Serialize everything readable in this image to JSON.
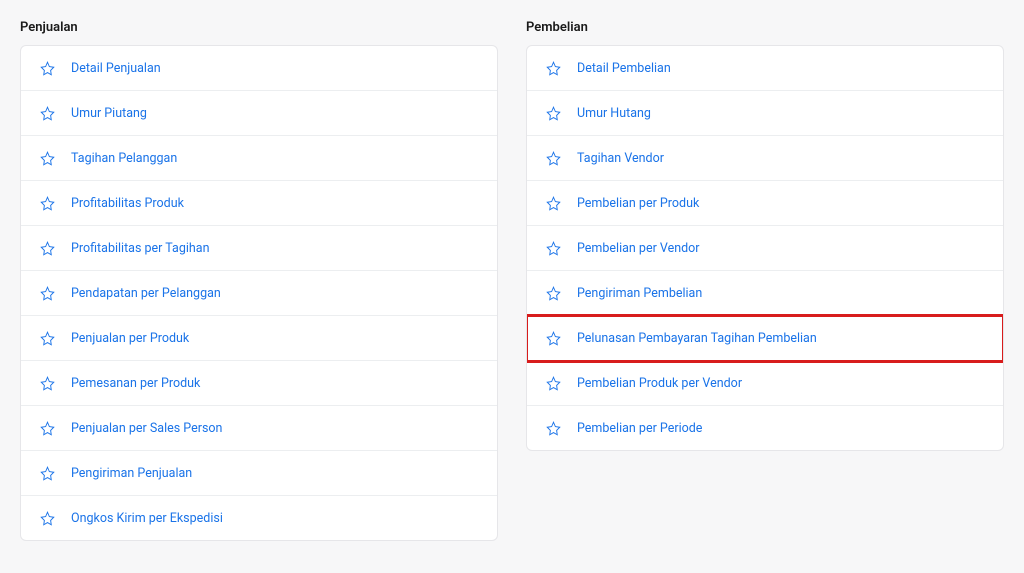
{
  "columns": [
    {
      "title": "Penjualan",
      "items": [
        {
          "label": "Detail Penjualan"
        },
        {
          "label": "Umur Piutang"
        },
        {
          "label": "Tagihan Pelanggan"
        },
        {
          "label": "Profitabilitas Produk"
        },
        {
          "label": "Profitabilitas per Tagihan"
        },
        {
          "label": "Pendapatan per Pelanggan"
        },
        {
          "label": "Penjualan per Produk"
        },
        {
          "label": "Pemesanan per Produk"
        },
        {
          "label": "Penjualan per Sales Person"
        },
        {
          "label": "Pengiriman Penjualan"
        },
        {
          "label": "Ongkos Kirim per Ekspedisi"
        }
      ]
    },
    {
      "title": "Pembelian",
      "items": [
        {
          "label": "Detail Pembelian"
        },
        {
          "label": "Umur Hutang"
        },
        {
          "label": "Tagihan Vendor"
        },
        {
          "label": "Pembelian per Produk"
        },
        {
          "label": "Pembelian per Vendor"
        },
        {
          "label": "Pengiriman Pembelian"
        },
        {
          "label": "Pelunasan Pembayaran Tagihan Pembelian",
          "highlighted": true
        },
        {
          "label": "Pembelian Produk per Vendor"
        },
        {
          "label": "Pembelian per Periode"
        }
      ]
    }
  ]
}
